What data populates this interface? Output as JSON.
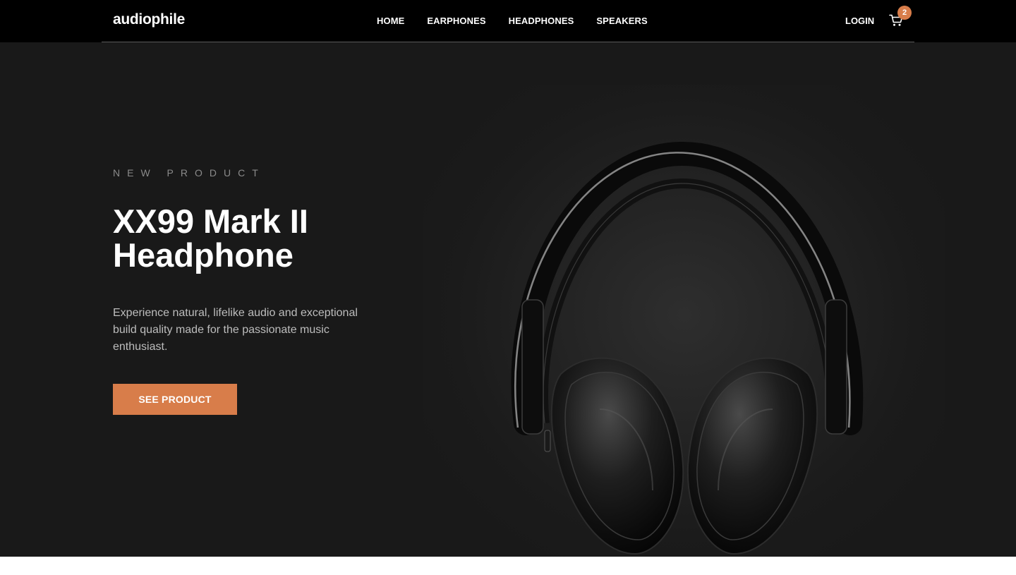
{
  "header": {
    "logo": "audiophile",
    "nav": [
      {
        "label": "HOME"
      },
      {
        "label": "EARPHONES"
      },
      {
        "label": "HEADPHONES"
      },
      {
        "label": "SPEAKERS"
      }
    ],
    "login": "LOGIN",
    "cart_count": "2",
    "cart_icon": "cart-icon"
  },
  "hero": {
    "overline": "NEW PRODUCT",
    "title": "XX99 Mark II Headphone",
    "description": "Experience natural, lifelike audio and exceptional build quality made for the passionate music enthusiast.",
    "cta": "SEE PRODUCT",
    "image": "headphones-image"
  },
  "colors": {
    "accent": "#d87d4a",
    "header_bg": "#000000",
    "hero_bg": "#191919",
    "text_light": "#ffffff"
  }
}
